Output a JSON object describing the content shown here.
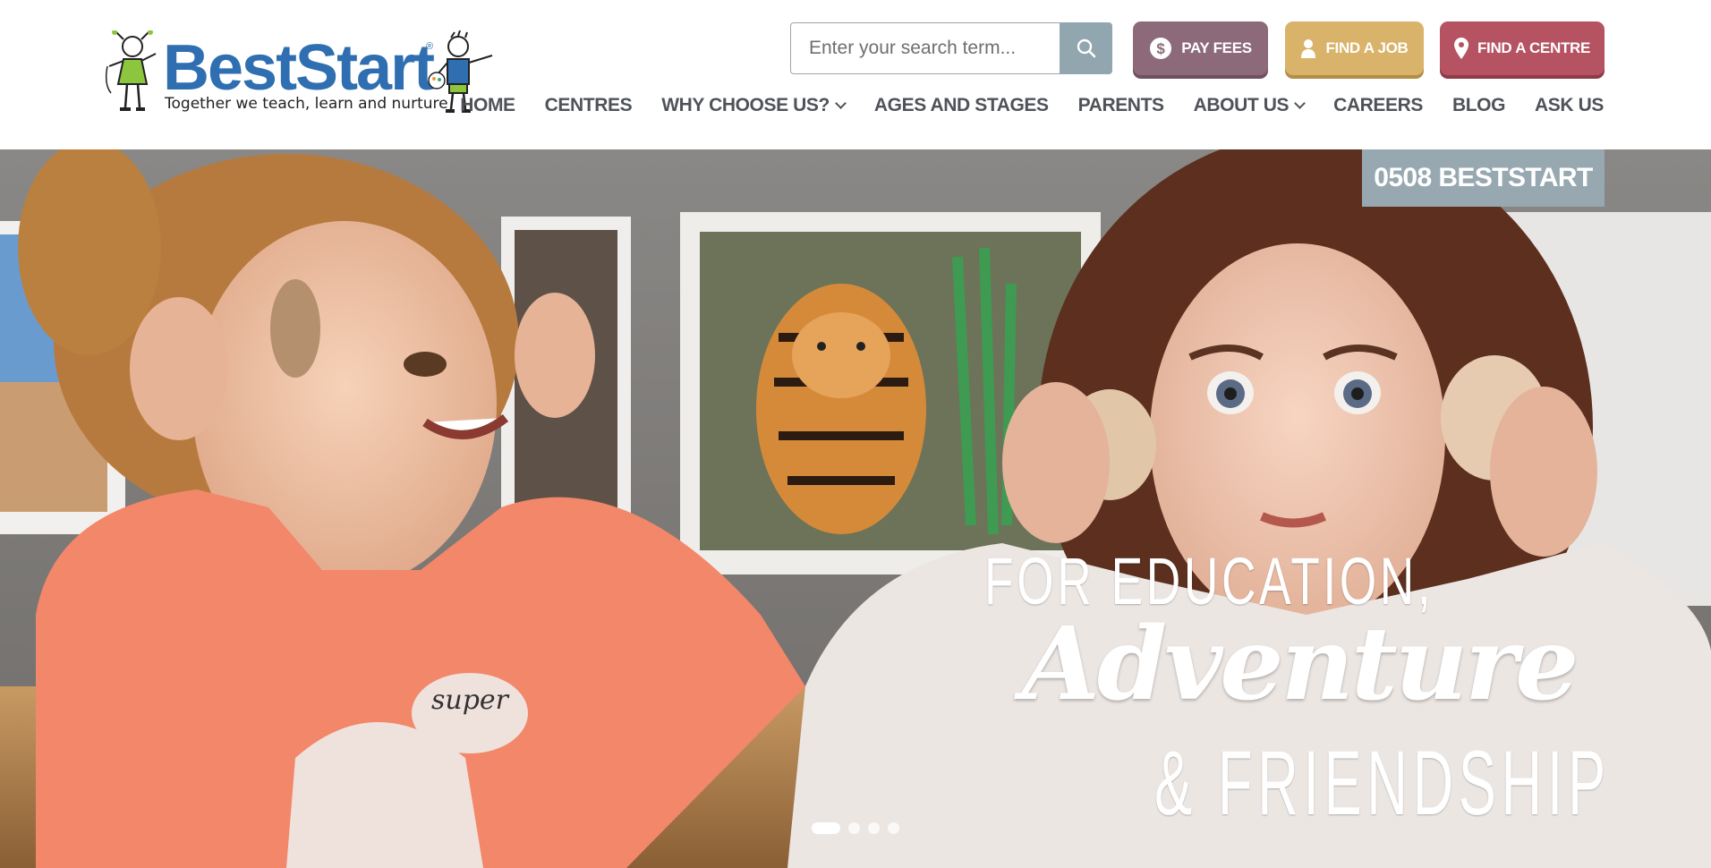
{
  "logo": {
    "name": "BestStart",
    "registered": "®",
    "tagline": "Together we teach, learn and nurture"
  },
  "search": {
    "placeholder": "Enter your search term..."
  },
  "quick_links": [
    {
      "label": "PAY FEES",
      "icon": "dollar-icon",
      "color": "#8d6a79"
    },
    {
      "label": "FIND A JOB",
      "icon": "person-icon",
      "color": "#d9b36a"
    },
    {
      "label": "FIND A CENTRE",
      "icon": "map-pin-icon",
      "color": "#b55362"
    }
  ],
  "nav": {
    "items": [
      {
        "label": "HOME",
        "dropdown": false
      },
      {
        "label": "CENTRES",
        "dropdown": false
      },
      {
        "label": "WHY CHOOSE US?",
        "dropdown": true
      },
      {
        "label": "AGES AND STAGES",
        "dropdown": false
      },
      {
        "label": "PARENTS",
        "dropdown": false
      },
      {
        "label": "ABOUT US",
        "dropdown": true
      },
      {
        "label": "CAREERS",
        "dropdown": false
      },
      {
        "label": "BLOG",
        "dropdown": false
      },
      {
        "label": "ASK US",
        "dropdown": false
      }
    ]
  },
  "hero": {
    "phone": "0508 BESTSTART",
    "line1": "FOR EDUCATION,",
    "line2": "Adventure",
    "line3": "& FRIENDSHIP",
    "slides_total": 4,
    "active_slide": 1
  }
}
